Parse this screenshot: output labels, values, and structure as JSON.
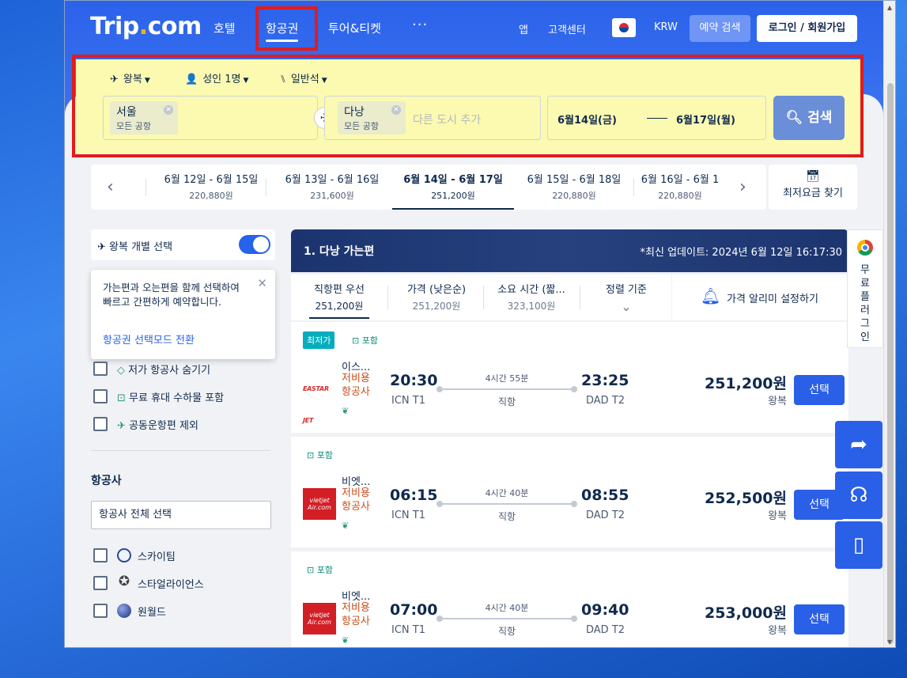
{
  "header": {
    "logo": "Trip.com",
    "nav": {
      "hotel": "호텔",
      "flight": "항공권",
      "tour": "투어&티켓",
      "more": "···"
    },
    "links": {
      "app": "앱",
      "support": "고객센터",
      "currency": "KRW"
    },
    "booking_search": "예약 검색",
    "login": "로그인 / 회원가입"
  },
  "search": {
    "trip_type": "왕복",
    "passengers": "성인 1명",
    "cabin": "일반석",
    "origin": {
      "city": "서울",
      "sub": "모든 공항"
    },
    "destination": {
      "city": "다낭",
      "sub": "모든 공항"
    },
    "add_city_placeholder": "다른 도시 추가",
    "depart_date": "6월14일(금)",
    "return_date": "6월17일(월)",
    "search_button": "검색"
  },
  "date_options": [
    {
      "range": "6월 12일 - 6월 15일",
      "price": "220,880원",
      "active": false
    },
    {
      "range": "6월 13일 - 6월 16일",
      "price": "231,600원",
      "active": false
    },
    {
      "range": "6월 14일 - 6월 17일",
      "price": "251,200원",
      "active": true
    },
    {
      "range": "6월 15일 - 6월 18일",
      "price": "220,880원",
      "active": false
    },
    {
      "range": "6월 16일 - 6월 1",
      "price": "220,880원",
      "active": false
    }
  ],
  "cheapest_finder": "최저요금 찾기",
  "sidebar": {
    "toggle_label": "왕복 개별 선택",
    "tooltip_text": "가는편과 오는편을 함께 선택하여 빠르고 간편하게 예약합니다.",
    "tooltip_link": "항공권 선택모드 전환",
    "filters": [
      {
        "label": "저가 항공사 숨기기",
        "icon": "tag-icon"
      },
      {
        "label": "무료 휴대 수하물 포함",
        "icon": "bag-icon"
      },
      {
        "label": "공동운항편 제외",
        "icon": "plane-icon"
      }
    ],
    "airline_title": "항공사",
    "airline_select": "항공사 전체 선택",
    "alliances": [
      {
        "label": "스카이팀",
        "icon": "skyteam-icon"
      },
      {
        "label": "스타얼라이언스",
        "icon": "star-alliance-icon"
      },
      {
        "label": "원월드",
        "icon": "oneworld-icon"
      }
    ]
  },
  "results": {
    "title": "1. 다낭 가는편",
    "updated": "*최신 업데이트: 2024년 6월 12일 16:17:30",
    "sort": [
      {
        "label": "직항편 우선",
        "value": "251,200원",
        "active": true
      },
      {
        "label": "가격 (낮은순)",
        "value": "251,200원",
        "active": false
      },
      {
        "label": "소요 시간 (짧...",
        "value": "323,100원",
        "active": false
      },
      {
        "label": "정렬 기준",
        "value": "⌄",
        "active": false
      }
    ],
    "price_alert": "가격 알리미 설정하기",
    "flights": [
      {
        "tags": [
          "최저가",
          "포함"
        ],
        "airline": "이스...",
        "lcc": "저비용\n항공사",
        "logo": "EASTAR JET",
        "dep": "20:30",
        "dep_ap": "ICN T1",
        "duration": "4시간 55분",
        "direct": "직항",
        "arr": "23:25",
        "arr_ap": "DAD T2",
        "price": "251,200원",
        "rt": "왕복",
        "select": "선택"
      },
      {
        "tags": [
          "포함"
        ],
        "airline": "비엣...",
        "lcc": "저비용\n항공사",
        "logo": "vietjet Air.com",
        "dep": "06:15",
        "dep_ap": "ICN T1",
        "duration": "4시간 40분",
        "direct": "직항",
        "arr": "08:55",
        "arr_ap": "DAD T2",
        "price": "252,500원",
        "rt": "왕복",
        "select": "선택"
      },
      {
        "tags": [
          "포함"
        ],
        "airline": "비엣...",
        "lcc": "저비용\n항공사",
        "logo": "vietjet Air.com",
        "dep": "07:00",
        "dep_ap": "ICN T1",
        "duration": "4시간 40분",
        "direct": "직항",
        "arr": "09:40",
        "arr_ap": "DAD T2",
        "price": "253,000원",
        "rt": "왕복",
        "select": "선택"
      }
    ]
  },
  "plugin": "무료플러그인",
  "fabs": [
    "share-icon",
    "headset-icon",
    "mobile-icon"
  ],
  "colors": {
    "brand": "#2b62ea",
    "primary_button": "#2a5fe8",
    "lcc": "#c94d1a",
    "highlight": "#fbfab0",
    "annotation": "#e31b1b"
  }
}
